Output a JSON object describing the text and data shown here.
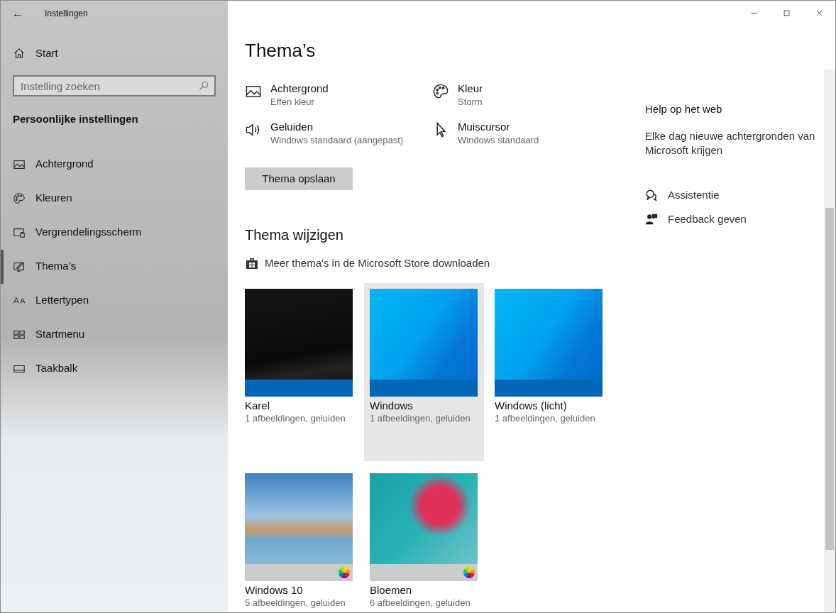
{
  "window": {
    "title": "Instellingen",
    "back": "←"
  },
  "sidebar": {
    "home": "Start",
    "search": {
      "placeholder": "Instelling zoeken"
    },
    "section": "Persoonlijke instellingen",
    "items": [
      {
        "label": "Achtergrond",
        "selected": false
      },
      {
        "label": "Kleuren",
        "selected": false
      },
      {
        "label": "Vergrendelingsscherm",
        "selected": false
      },
      {
        "label": "Thema’s",
        "selected": true
      },
      {
        "label": "Lettertypen",
        "selected": false
      },
      {
        "label": "Startmenu",
        "selected": false
      },
      {
        "label": "Taakbalk",
        "selected": false
      }
    ]
  },
  "main": {
    "title": "Thema’s",
    "settings": [
      {
        "label": "Achtergrond",
        "value": "Effen kleur"
      },
      {
        "label": "Kleur",
        "value": "Storm"
      },
      {
        "label": "Geluiden",
        "value": "Windows standaard (aangepast)"
      },
      {
        "label": "Muiscursor",
        "value": "Windows standaard"
      }
    ],
    "save_button": "Thema opslaan",
    "change_heading": "Thema wijzigen",
    "store_link": "Meer thema's in de Microsoft Store downloaden",
    "themes": [
      {
        "name": "Karel",
        "details": "1 afbeeldingen, geluiden",
        "kind": "dark",
        "selected": false
      },
      {
        "name": "Windows",
        "details": "1 afbeeldingen, geluiden",
        "kind": "blue",
        "selected": true
      },
      {
        "name": "Windows (licht)",
        "details": "1 afbeeldingen, geluiden",
        "kind": "blue",
        "selected": false
      },
      {
        "name": "Windows 10",
        "details": "5 afbeeldingen, geluiden",
        "kind": "beach",
        "selected": false
      },
      {
        "name": "Bloemen",
        "details": "6 afbeeldingen, geluiden",
        "kind": "flower",
        "selected": false
      }
    ]
  },
  "aside": {
    "heading": "Help op het web",
    "link": "Elke dag nieuwe achtergronden van Microsoft krijgen",
    "actions": [
      {
        "label": "Assistentie"
      },
      {
        "label": "Feedback geven"
      }
    ]
  }
}
